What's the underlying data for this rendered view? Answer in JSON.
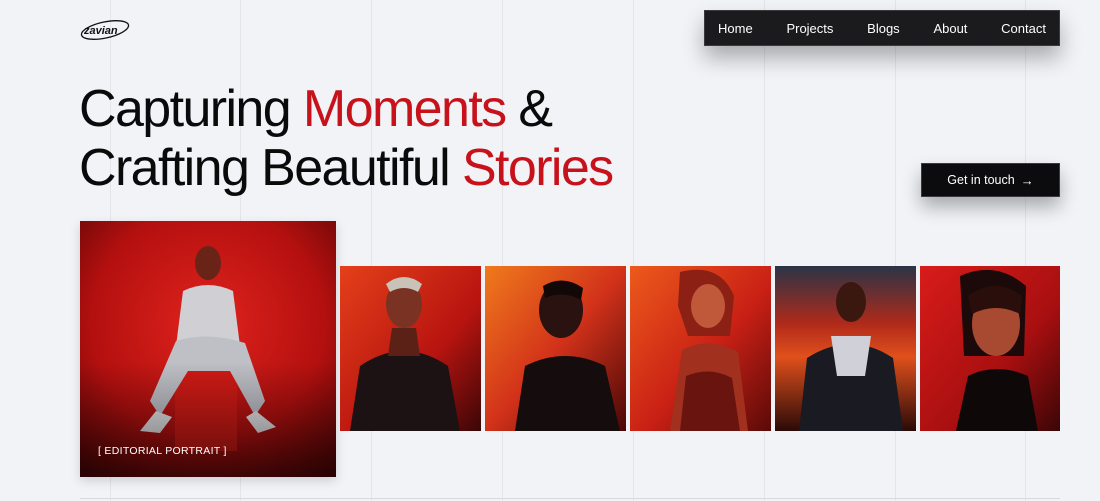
{
  "brand": {
    "logo_text": "zavian"
  },
  "nav": {
    "items": [
      {
        "label": "Home"
      },
      {
        "label": "Projects"
      },
      {
        "label": "Blogs"
      },
      {
        "label": "About"
      },
      {
        "label": "Contact"
      }
    ]
  },
  "hero": {
    "line1_a": "Capturing ",
    "line1_accent": "Moments",
    "line1_b": " &",
    "line2_a": "Crafting Beautiful ",
    "line2_accent": "Stories",
    "accent_color": "#c8121b"
  },
  "cta": {
    "label": "Get in touch",
    "icon": "arrow-right-icon"
  },
  "gallery": {
    "feature_caption": "[ EDITORIAL PORTRAIT ]",
    "photos": [
      {
        "name": "editorial-portrait-photo"
      },
      {
        "name": "portrait-photo-1"
      },
      {
        "name": "portrait-photo-2"
      },
      {
        "name": "portrait-photo-3"
      },
      {
        "name": "portrait-photo-4"
      },
      {
        "name": "portrait-photo-5"
      }
    ]
  }
}
